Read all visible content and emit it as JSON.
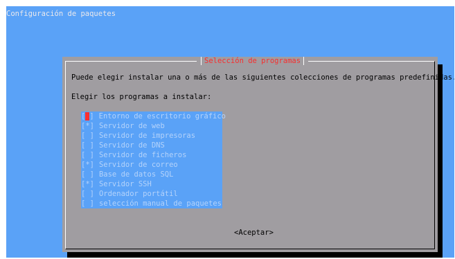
{
  "app": {
    "back_title": "Configuración de paquetes"
  },
  "dialog": {
    "title": "Selección de programas",
    "description": "Puede elegir instalar una o más de las siguientes colecciones de programas predefinidas.",
    "prompt": "Elegir los programas a instalar:",
    "ok_label": "<Aceptar>"
  },
  "software": {
    "items": [
      {
        "mark": "[ ]",
        "label": "Entorno de escritorio gráfico",
        "checked": false,
        "focused": true
      },
      {
        "mark": "[*]",
        "label": "Servidor de web",
        "checked": true,
        "focused": false
      },
      {
        "mark": "[ ]",
        "label": "Servidor de impresoras",
        "checked": false,
        "focused": false
      },
      {
        "mark": "[ ]",
        "label": "Servidor de DNS",
        "checked": false,
        "focused": false
      },
      {
        "mark": "[ ]",
        "label": "Servidor de ficheros",
        "checked": false,
        "focused": false
      },
      {
        "mark": "[*]",
        "label": "Servidor de correo",
        "checked": true,
        "focused": false
      },
      {
        "mark": "[ ]",
        "label": "Base de datos SQL",
        "checked": false,
        "focused": false
      },
      {
        "mark": "[*]",
        "label": "Servidor SSH",
        "checked": true,
        "focused": false
      },
      {
        "mark": "[ ]",
        "label": "Ordenador portátil",
        "checked": false,
        "focused": false
      },
      {
        "mark": "[ ]",
        "label": "selección manual de paquetes",
        "checked": false,
        "focused": false
      }
    ]
  },
  "colors": {
    "screen_bg": "#5aa2f7",
    "dialog_bg": "#a09da1",
    "title": "#f72f2f",
    "cursor": "#ff3030",
    "list_text": "#b4d3fb"
  }
}
